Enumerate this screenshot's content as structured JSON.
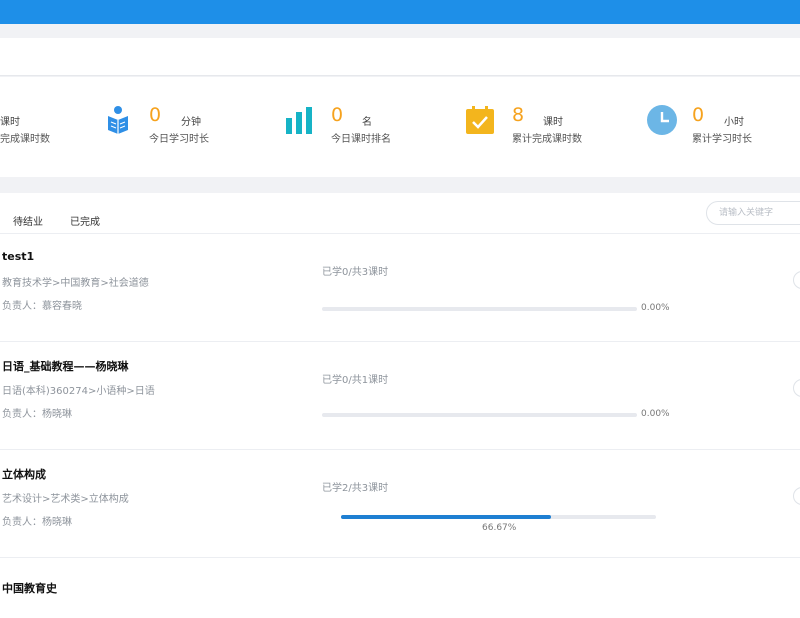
{
  "stats": [
    {
      "value": "",
      "unit": "课时",
      "label": "完成课时数",
      "icon": "partial-stat-icon",
      "icon_color": ""
    },
    {
      "value": "0",
      "unit": "分钟",
      "label": "今日学习时长",
      "icon": "reading-person-icon",
      "icon_color": "#2f8fe6"
    },
    {
      "value": "0",
      "unit": "名",
      "label": "今日课时排名",
      "icon": "bar-chart-icon",
      "icon_color": "#16b3c6"
    },
    {
      "value": "8",
      "unit": "课时",
      "label": "累计完成课时数",
      "icon": "calendar-check-icon",
      "icon_color": "#f3b51d"
    },
    {
      "value": "0",
      "unit": "小时",
      "label": "累计学习时长",
      "icon": "clock-icon",
      "icon_color": "#6cb6e6"
    }
  ],
  "tabs": [
    "待结业",
    "已完成"
  ],
  "search": {
    "placeholder": "请输入关键字"
  },
  "courses": [
    {
      "title": "test1",
      "path": "教育技术学>中国教育>社会道德",
      "owner": "负责人：慕容春晓",
      "study": "已学0/共3课时",
      "progress": 0.0,
      "progress_label": "0.00%"
    },
    {
      "title": "日语_基础教程——杨晓琳",
      "path": "日语(本科)360274>小语种>日语",
      "owner": "负责人：杨晓琳",
      "study": "已学0/共1课时",
      "progress": 0.0,
      "progress_label": "0.00%"
    },
    {
      "title": "立体构成",
      "path": "艺术设计>艺术类>立体构成",
      "owner": "负责人：杨晓琳",
      "study": "已学2/共3课时",
      "progress": 0.6667,
      "progress_label": "66.67%"
    },
    {
      "title": "中国教育史"
    }
  ],
  "colors": {
    "primary": "#1e8fe8",
    "accent_number": "#f6a21d",
    "progress_fill": "#1e7fd2"
  }
}
